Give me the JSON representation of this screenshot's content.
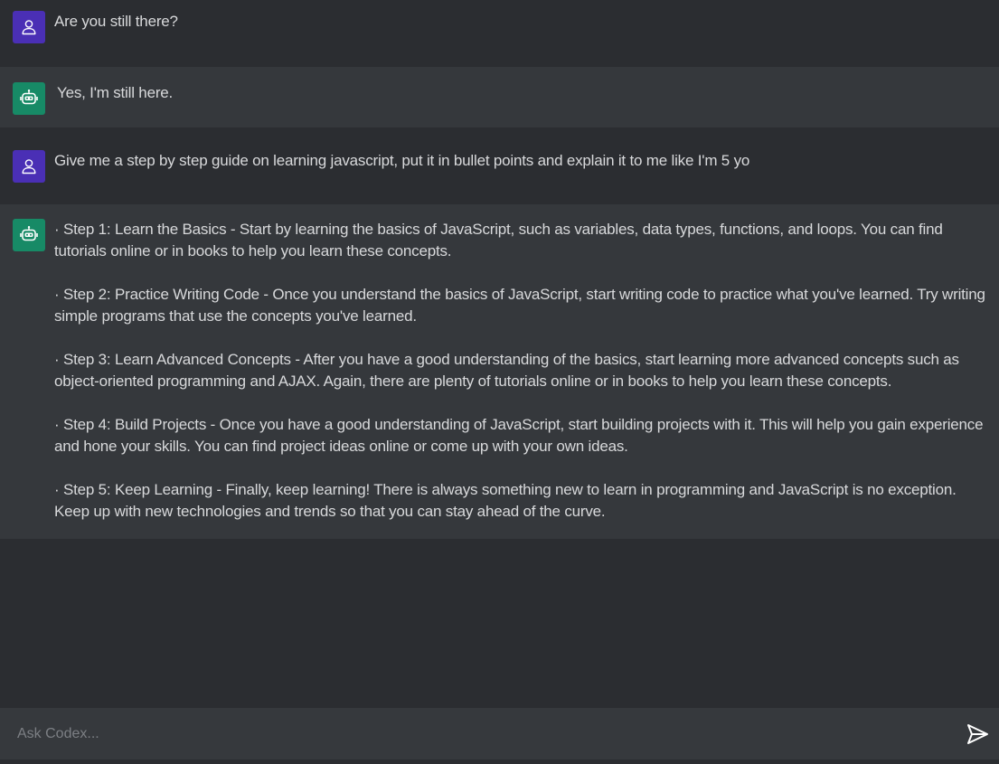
{
  "messages": [
    {
      "role": "user",
      "text": "Are you still there?"
    },
    {
      "role": "bot",
      "text": "Yes, I'm still here."
    },
    {
      "role": "user",
      "text": "Give me a step by step guide on learning javascript, put it in bullet points and explain it to me like I'm 5 yo"
    },
    {
      "role": "bot",
      "steps": [
        "· Step 1: Learn the Basics - Start by learning the basics of JavaScript, such as variables, data types, functions, and loops. You can find tutorials online or in books to help you learn these concepts.",
        "· Step 2: Practice Writing Code - Once you understand the basics of JavaScript, start writing code to practice what you've learned. Try writing simple programs that use the concepts you've learned.",
        "· Step 3: Learn Advanced Concepts - After you have a good understanding of the basics, start learning more advanced concepts such as object-oriented programming and AJAX. Again, there are plenty of tutorials online or in books to help you learn these concepts.",
        "· Step 4: Build Projects - Once you have a good understanding of JavaScript, start building projects with it. This will help you gain experience and hone your skills. You can find project ideas online or come up with your own ideas.",
        "· Step 5: Keep Learning - Finally, keep learning! There is always something new to learn in programming and JavaScript is no exception. Keep up with new technologies and trends so that you can stay ahead of the curve."
      ]
    }
  ],
  "composer": {
    "placeholder": "Ask Codex...",
    "value": ""
  },
  "icons": {
    "user_avatar": "person-icon",
    "bot_avatar": "robot-icon",
    "send": "send-icon"
  },
  "colors": {
    "user_avatar_bg": "#4a2fb5",
    "bot_avatar_bg": "#178a66",
    "bot_row_bg": "#35383c",
    "page_bg": "#2b2d31"
  }
}
